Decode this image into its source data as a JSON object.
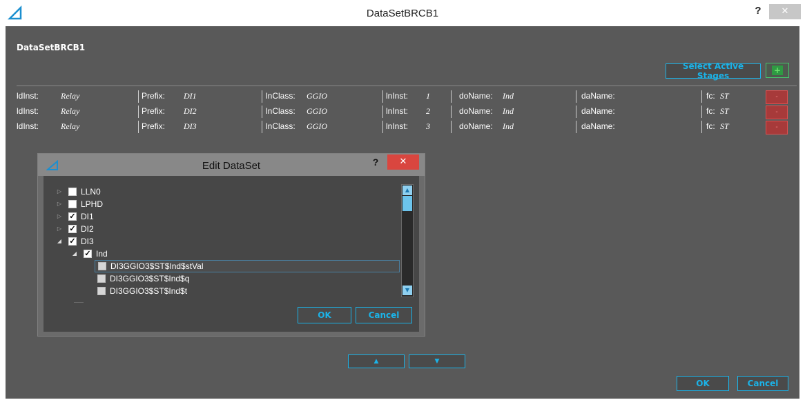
{
  "window": {
    "title": "DataSetBRCB1",
    "help_label": "?",
    "close_label": "✕"
  },
  "main": {
    "heading": "DataSetBRCB1",
    "select_stages_label": "Select Active Stages",
    "add_label": "+",
    "up_label": "▲",
    "down_label": "▼",
    "ok_label": "OK",
    "cancel_label": "Cancel"
  },
  "dataset_rows": [
    {
      "ldinst_label": "ldInst:",
      "ldinst": "Relay",
      "prefix_label": "Prefix:",
      "prefix": "DI1",
      "lnclass_label": "lnClass:",
      "lnclass": "GGIO",
      "lninst_label": "lnInst:",
      "lninst": "1",
      "doname_label": "doName:",
      "doname": "Ind",
      "daname_label": "daName:",
      "daname": "",
      "fc_label": "fc:",
      "fc": "ST",
      "remove_label": "-"
    },
    {
      "ldinst_label": "ldInst:",
      "ldinst": "Relay",
      "prefix_label": "Prefix:",
      "prefix": "DI2",
      "lnclass_label": "lnClass:",
      "lnclass": "GGIO",
      "lninst_label": "lnInst:",
      "lninst": "2",
      "doname_label": "doName:",
      "doname": "Ind",
      "daname_label": "daName:",
      "daname": "",
      "fc_label": "fc:",
      "fc": "ST",
      "remove_label": "-"
    },
    {
      "ldinst_label": "ldInst:",
      "ldinst": "Relay",
      "prefix_label": "Prefix:",
      "prefix": "DI3",
      "lnclass_label": "lnClass:",
      "lnclass": "GGIO",
      "lninst_label": "lnInst:",
      "lninst": "3",
      "doname_label": "doName:",
      "doname": "Ind",
      "daname_label": "daName:",
      "daname": "",
      "fc_label": "fc:",
      "fc": "ST",
      "remove_label": "-"
    }
  ],
  "dialog": {
    "title": "Edit DataSet",
    "help_label": "?",
    "close_label": "✕",
    "tree": [
      {
        "label": "LLN0",
        "checked": false,
        "expander": "closed"
      },
      {
        "label": "LPHD",
        "checked": false,
        "expander": "closed"
      },
      {
        "label": "DI1",
        "checked": true,
        "expander": "closed"
      },
      {
        "label": "DI2",
        "checked": true,
        "expander": "closed"
      },
      {
        "label": "DI3",
        "checked": true,
        "expander": "open"
      },
      {
        "label": "Ind",
        "checked": true,
        "expander": "open"
      },
      {
        "label": "DI3GGIO3$ST$Ind$stVal",
        "checked": false,
        "selected": true
      },
      {
        "label": "DI3GGIO3$ST$Ind$q",
        "checked": false
      },
      {
        "label": "DI3GGIO3$ST$Ind$t",
        "checked": false
      }
    ],
    "ok_label": "OK",
    "cancel_label": "Cancel"
  },
  "colors": {
    "accent": "#1bb3e8",
    "background": "#595959",
    "dialog_body": "#474747",
    "remove": "#a73a3a",
    "add": "#2f9a43",
    "close": "#d9463f"
  },
  "icons": {
    "app_logo": "triangle-logo-icon",
    "check": "checkmark-icon",
    "expander_closed": "triangle-right-icon",
    "expander_open": "triangle-down-icon"
  }
}
